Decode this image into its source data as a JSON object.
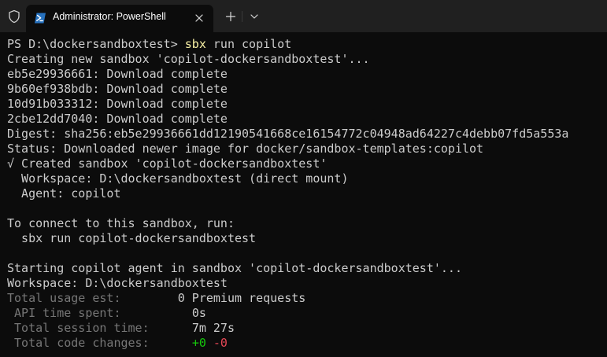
{
  "window": {
    "tab_title": "Administrator: PowerShell"
  },
  "colors": {
    "terminal_background": "#0c0c0c",
    "tabbar_background": "#202020",
    "text": "#cccccc",
    "command": "#f9f1a5",
    "dim": "#767676",
    "added": "#16c60c",
    "removed": "#e74856"
  },
  "terminal": {
    "prompt": "PS D:\\dockersandboxtest> ",
    "command": "sbx",
    "command_args": " run copilot",
    "lines": [
      "Creating new sandbox 'copilot-dockersandboxtest'...",
      "eb5e29936661: Download complete",
      "9b60ef938bdb: Download complete",
      "10d91b033312: Download complete",
      "2cbe12dd7040: Download complete",
      "Digest: sha256:eb5e29936661dd12190541668ce16154772c04948ad64227c4debb07fd5a553a",
      "Status: Downloaded newer image for docker/sandbox-templates:copilot",
      "√ Created sandbox 'copilot-dockersandboxtest'",
      "  Workspace: D:\\dockersandboxtest (direct mount)",
      "  Agent: copilot",
      "",
      "To connect to this sandbox, run:",
      "  sbx run copilot-dockersandboxtest",
      "",
      "Starting copilot agent in sandbox 'copilot-dockersandboxtest'...",
      "Workspace: D:\\dockersandboxtest"
    ],
    "usage": {
      "total_usage_label": "Total usage est:        ",
      "total_usage_value": "0 Premium requests",
      "api_time_label": " API time spent:          ",
      "api_time_value": "0s",
      "session_time_label": " Total session time:      ",
      "session_time_value": "7m 27s",
      "code_changes_label": " Total code changes:      ",
      "code_added": "+0",
      "code_removed": "-0"
    }
  }
}
